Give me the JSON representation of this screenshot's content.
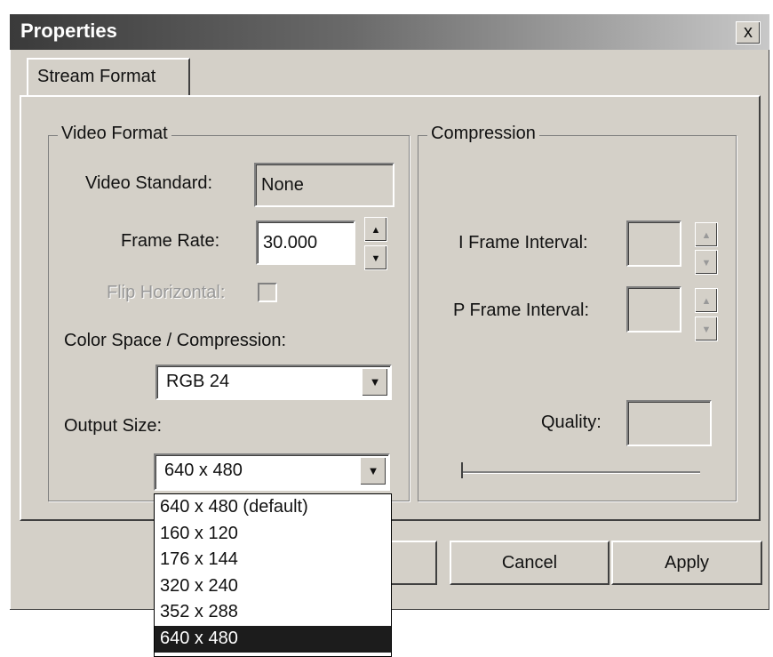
{
  "window": {
    "title": "Properties",
    "close_label": "x"
  },
  "tabs": [
    {
      "label": "Stream Format"
    }
  ],
  "video_format": {
    "title": "Video Format",
    "video_standard": {
      "label": "Video Standard:",
      "value": "None"
    },
    "frame_rate": {
      "label": "Frame Rate:",
      "value": "30.000"
    },
    "flip_horizontal": {
      "label": "Flip Horizontal:",
      "enabled": false,
      "checked": false
    },
    "color_space": {
      "label": "Color Space / Compression:",
      "value": "RGB 24"
    },
    "output_size": {
      "label": "Output Size:",
      "value": "640 x 480",
      "options": [
        "640 x 480  (default)",
        "160 x 120",
        "176 x 144",
        "320 x 240",
        "352 x 288",
        "640 x 480"
      ],
      "highlighted_index": 5
    }
  },
  "compression": {
    "title": "Compression",
    "i_frame_interval": {
      "label": "I Frame Interval:",
      "value": ""
    },
    "p_frame_interval": {
      "label": "P Frame Interval:",
      "value": ""
    },
    "quality": {
      "label": "Quality:",
      "value": ""
    }
  },
  "buttons": {
    "cancel": "Cancel",
    "apply": "Apply"
  },
  "icons": {
    "up_arrow": "triangle-up-icon",
    "down_arrow": "triangle-down-icon"
  }
}
